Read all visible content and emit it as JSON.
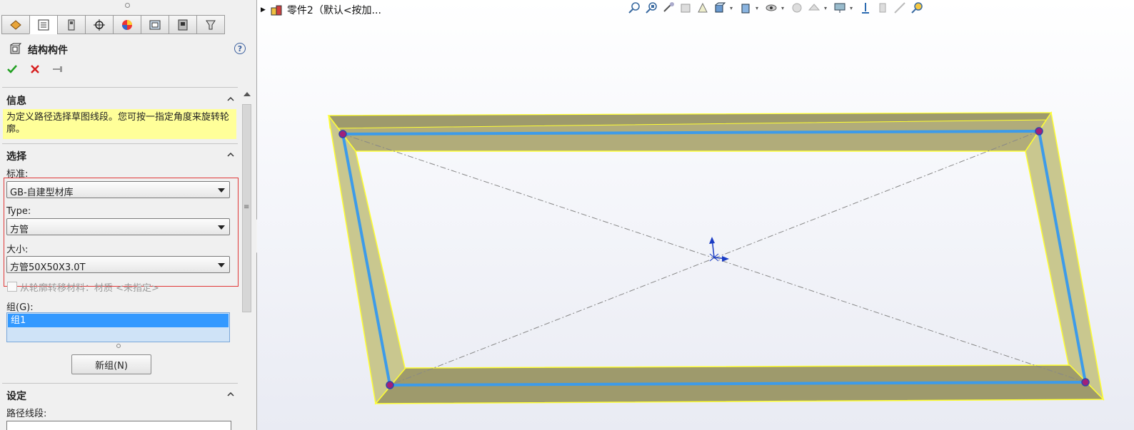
{
  "property_manager": {
    "title": "结构构件",
    "tabs": [
      "feature-manager",
      "property-manager",
      "configuration-manager",
      "dimxpert-manager",
      "display-manager",
      "cam-manager",
      "simulation-manager",
      "custom-manager"
    ],
    "info": {
      "header": "信息",
      "message": "为定义路径选择草图线段。您可按一指定角度来旋转轮廓。"
    },
    "selection": {
      "header": "选择",
      "standard_label": "标准:",
      "standard_value": "GB-自建型材库",
      "type_label": "Type:",
      "type_value": "方管",
      "size_label": "大小:",
      "size_value": "方管50X50X3.0T",
      "transfer_material_label": "从轮廓转移材料：材质 <未指定>",
      "group_label": "组(G):",
      "groups": [
        "组1"
      ],
      "new_group_button": "新组(N)"
    },
    "settings": {
      "header": "设定",
      "path_segments_label": "路径线段:"
    }
  },
  "feature_tree": {
    "part_label": "零件2（默认<按加..."
  },
  "colors": {
    "highlight_yellow": "#ffff99",
    "selection_blue": "#3399ff",
    "frame_yellow": "#ffff33",
    "path_blue": "#3d9be9"
  }
}
